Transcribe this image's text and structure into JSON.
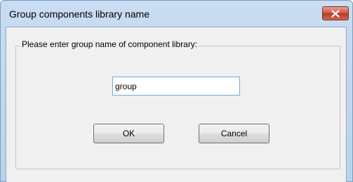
{
  "window": {
    "title": "Group components library name",
    "close_icon": "close-icon"
  },
  "group": {
    "legend": "Please enter group name of component library:"
  },
  "name_field": {
    "value": "group"
  },
  "buttons": {
    "ok_label": "OK",
    "cancel_label": "Cancel"
  },
  "colors": {
    "title_bar": "#bcd2ec",
    "close_button": "#c9553f",
    "dialog_background": "#f0f0f0",
    "input_border": "#7aa7d6"
  }
}
